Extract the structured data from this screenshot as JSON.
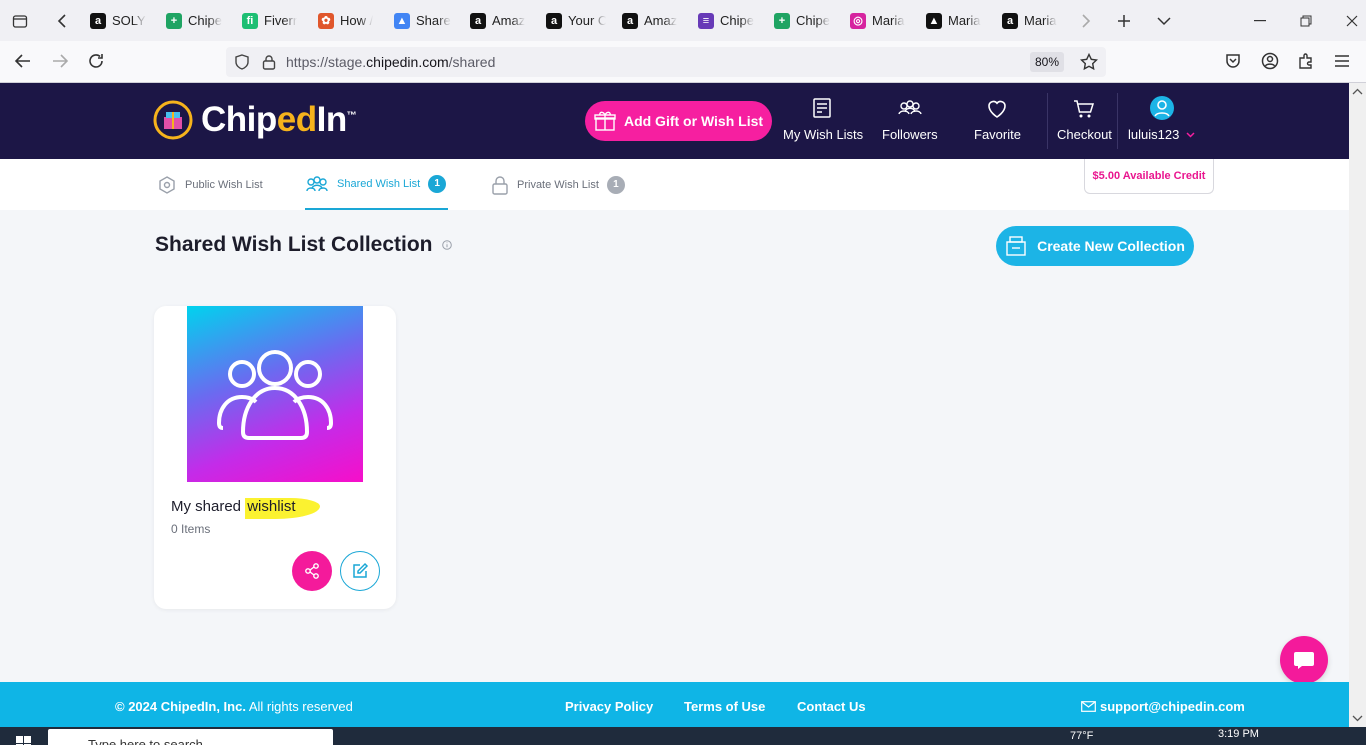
{
  "browser": {
    "tabs": [
      {
        "label": "SOLY",
        "color": "#111",
        "glyph": "a"
      },
      {
        "label": "Chipe",
        "color": "#1fa463",
        "glyph": "+"
      },
      {
        "label": "Fiverr",
        "color": "#1dbf73",
        "glyph": "fi"
      },
      {
        "label": "How /",
        "color": "#e0562b",
        "glyph": "✿"
      },
      {
        "label": "Share",
        "color": "#4285f4",
        "glyph": "▲"
      },
      {
        "label": "Amaz",
        "color": "#111",
        "glyph": "a"
      },
      {
        "label": "Your C",
        "color": "#111",
        "glyph": "a"
      },
      {
        "label": "Amaz",
        "color": "#111",
        "glyph": "a"
      },
      {
        "label": "Chipe",
        "color": "#673ab7",
        "glyph": "≡"
      },
      {
        "label": "Chipe",
        "color": "#1fa463",
        "glyph": "+"
      },
      {
        "label": "Maria",
        "color": "#d6249f",
        "glyph": "◎"
      },
      {
        "label": "Maria",
        "color": "#111",
        "glyph": "▲"
      },
      {
        "label": "Maria",
        "color": "#111",
        "glyph": "a"
      }
    ],
    "url_prefix": "https://stage.",
    "url_domain": "chipedin.com",
    "url_path": "/shared",
    "zoom": "80%"
  },
  "header": {
    "logo_text_a": "Chip",
    "logo_text_b": "ed",
    "logo_text_c": "In",
    "logo_tm": "™",
    "add_gift_label": "Add Gift or Wish List",
    "nav": {
      "my_wish_lists": "My Wish Lists",
      "followers": "Followers",
      "favorite": "Favorite",
      "checkout": "Checkout",
      "user": "luluis123"
    }
  },
  "tabs": {
    "public": {
      "label": "Public Wish List"
    },
    "shared": {
      "label": "Shared Wish List",
      "count": "1"
    },
    "private": {
      "label": "Private Wish List",
      "count": "1"
    }
  },
  "credit": "$5.00 Available Credit",
  "main": {
    "title": "Shared Wish List Collection",
    "create_label": "Create New Collection",
    "collections": [
      {
        "title_a": "My shared ",
        "title_b": "wishlist",
        "items": "0 Items"
      }
    ]
  },
  "footer": {
    "copyright_bold": "© 2024 ChipedIn, Inc.",
    "copyright_rest": " All rights reserved",
    "privacy": "Privacy Policy",
    "terms": "Terms of Use",
    "contact": "Contact Us",
    "email": "support@chipedin.com"
  },
  "taskbar": {
    "search_placeholder": "Type here to search",
    "time": "3:19 PM",
    "temp": "77°F"
  },
  "colors": {
    "header_bg": "#1c1646",
    "brand_pink": "#f61fa0",
    "brand_cyan": "#1cb4e6",
    "footer_bg": "#0fb5e6"
  }
}
